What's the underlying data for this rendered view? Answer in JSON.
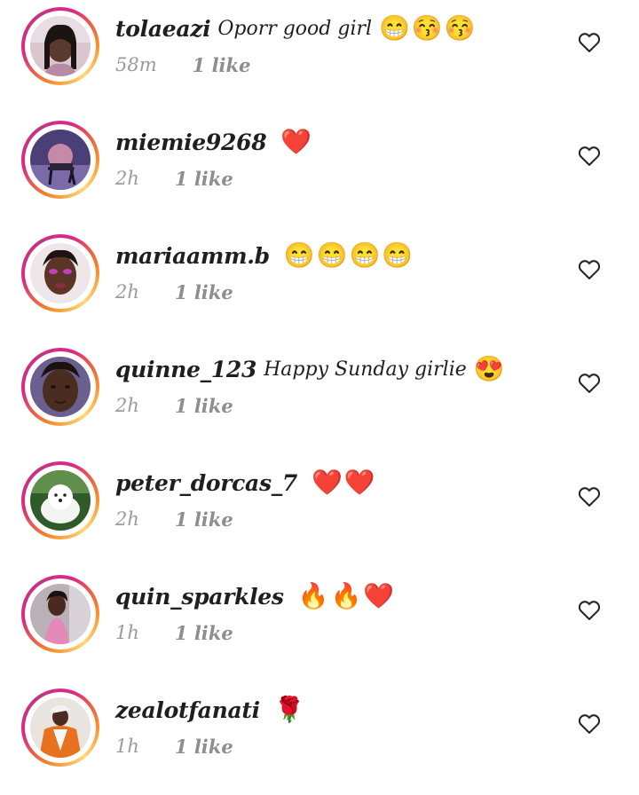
{
  "comments": [
    {
      "username": "tolaeazi",
      "text": "Oporr good girl",
      "emojis": "😁😚😚",
      "time": "58m",
      "likes": "1 like",
      "avatar": "avatar-woman-selfie"
    },
    {
      "username": "miemie9268",
      "text": "",
      "emojis": "❤️",
      "time": "2h",
      "likes": "1 like",
      "avatar": "avatar-chair-purple"
    },
    {
      "username": "mariaamm.b",
      "text": "",
      "emojis": "😁😁😁😁",
      "time": "2h",
      "likes": "1 like",
      "avatar": "avatar-makeup-portrait"
    },
    {
      "username": "quinne_123",
      "text": "Happy Sunday girlie",
      "emojis": "😍",
      "time": "2h",
      "likes": "1 like",
      "avatar": "avatar-girl-portrait"
    },
    {
      "username": "peter_dorcas_7",
      "text": "",
      "emojis": "❤️❤️",
      "time": "2h",
      "likes": "1 like",
      "avatar": "avatar-white-dog"
    },
    {
      "username": "quin_sparkles",
      "text": "",
      "emojis": "🔥🔥❤️",
      "time": "1h",
      "likes": "1 like",
      "avatar": "avatar-girl-pink"
    },
    {
      "username": "zealotfanati",
      "text": "",
      "emojis": "🌹",
      "time": "1h",
      "likes": "1 like",
      "avatar": "avatar-man-orange-jacket"
    }
  ],
  "icons": {
    "like": "heart-outline-icon"
  },
  "colors": {
    "username": "#1f1f1f",
    "meta": "#9a9a9a",
    "heart_outline": "#262626"
  }
}
